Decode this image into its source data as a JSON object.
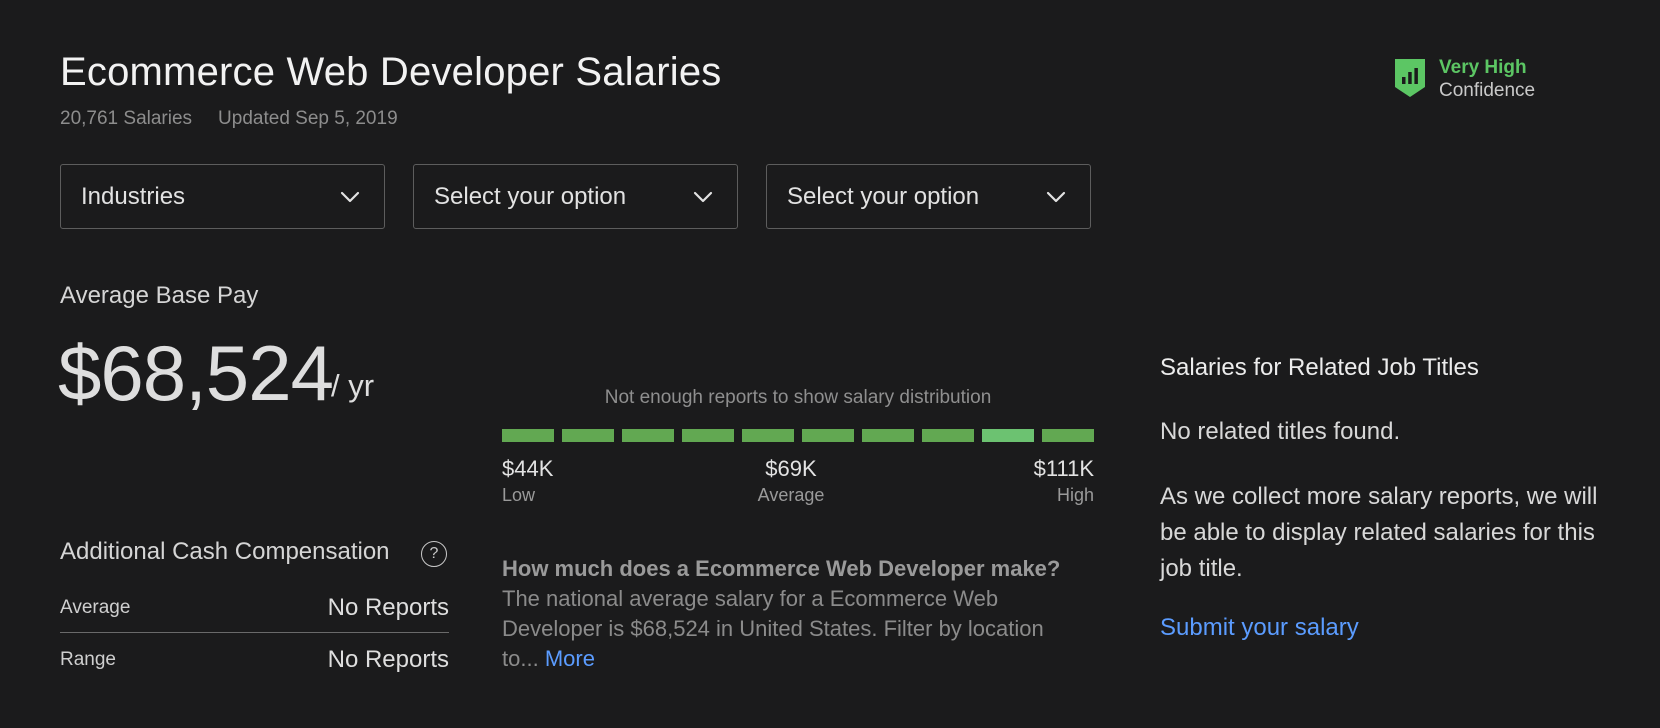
{
  "header": {
    "title": "Ecommerce Web Developer Salaries",
    "salary_count": "20,761 Salaries",
    "updated": "Updated Sep 5, 2019"
  },
  "confidence": {
    "level": "Very High",
    "label": "Confidence",
    "icon": "bar-chart-shield-icon",
    "color": "#5cc664"
  },
  "filters": [
    {
      "label": "Industries",
      "icon": "chevron-down-icon"
    },
    {
      "label": "Select your option",
      "icon": "chevron-down-icon"
    },
    {
      "label": "Select your option",
      "icon": "chevron-down-icon"
    }
  ],
  "base_pay": {
    "label": "Average Base Pay",
    "value": "$68,524",
    "unit": "/ yr"
  },
  "distribution": {
    "note": "Not enough reports to show salary distribution",
    "segment_count": 10,
    "highlight_segment": 8,
    "bar_color": "#62a852",
    "highlight_color": "#6cc271",
    "low": {
      "value": "$44K",
      "label": "Low"
    },
    "average": {
      "value": "$69K",
      "label": "Average"
    },
    "high": {
      "value": "$111K",
      "label": "High"
    }
  },
  "faq": {
    "question": "How much does a Ecommerce Web Developer make?",
    "answer": "The national average salary for a Ecommerce Web Developer is $68,524 in United States. Filter by location to...",
    "more_label": "More"
  },
  "additional_cash": {
    "title": "Additional Cash Compensation",
    "help_icon_glyph": "?",
    "rows": [
      {
        "key": "Average",
        "value": "No Reports"
      },
      {
        "key": "Range",
        "value": "No Reports"
      }
    ]
  },
  "related": {
    "title": "Salaries for Related Job Titles",
    "none_found": "No related titles found.",
    "message": "As we collect more salary reports, we will be able to display related salaries for this job title.",
    "submit_label": "Submit your salary"
  }
}
